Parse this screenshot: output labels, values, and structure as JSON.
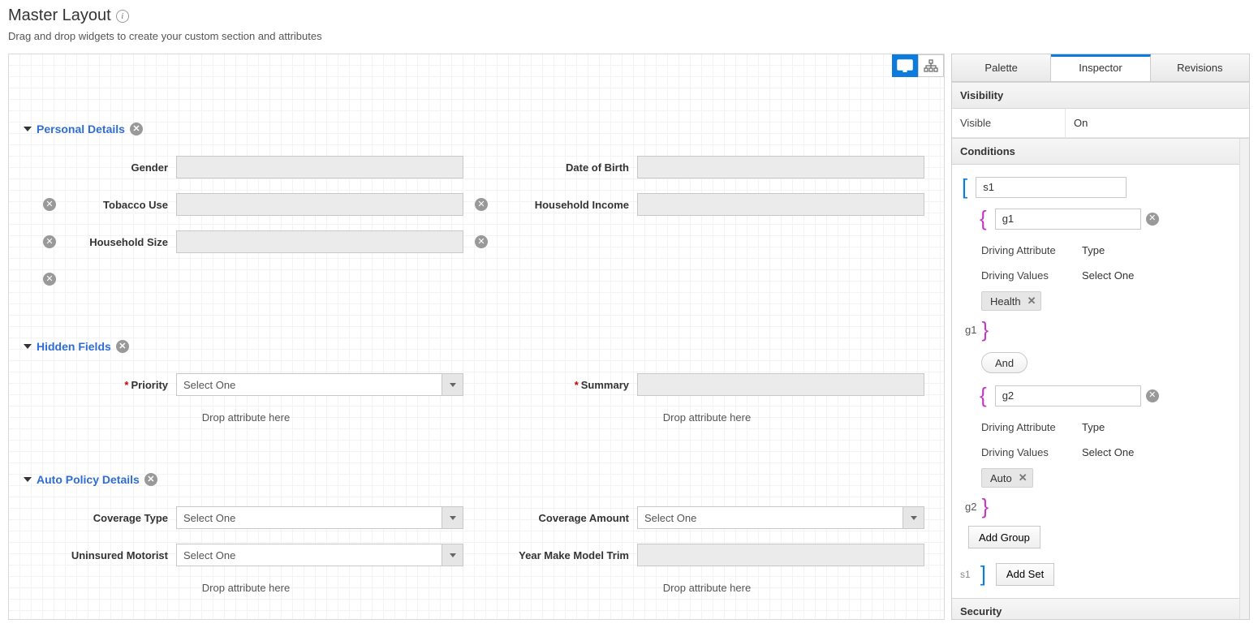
{
  "header": {
    "title": "Master Layout",
    "subtitle": "Drag and drop widgets to create your custom section and attributes"
  },
  "canvas": {
    "select_placeholder": "Select One",
    "drop_hint": "Drop attribute here",
    "sections": {
      "personal": {
        "title": "Personal Details",
        "fields": {
          "gender": "Gender",
          "dob": "Date of Birth",
          "tobacco": "Tobacco Use",
          "income": "Household Income",
          "hh_size": "Household Size"
        }
      },
      "hidden": {
        "title": "Hidden Fields",
        "fields": {
          "priority": "Priority",
          "summary": "Summary"
        }
      },
      "auto": {
        "title": "Auto Policy Details",
        "fields": {
          "ctype": "Coverage Type",
          "camount": "Coverage Amount",
          "umotor": "Uninsured Motorist",
          "ymmt": "Year Make Model Trim"
        }
      }
    }
  },
  "panel": {
    "tabs": {
      "palette": "Palette",
      "inspector": "Inspector",
      "revisions": "Revisions"
    },
    "visibility": {
      "header": "Visibility",
      "visible_label": "Visible",
      "visible_value": "On"
    },
    "conditions": {
      "header": "Conditions",
      "set_id": "s1",
      "groups": [
        {
          "id": "g1",
          "driving_attr_label": "Driving Attribute",
          "driving_attr_value": "Type",
          "driving_values_label": "Driving Values",
          "driving_values_value": "Select One",
          "chip": "Health"
        },
        {
          "id": "g2",
          "driving_attr_label": "Driving Attribute",
          "driving_attr_value": "Type",
          "driving_values_label": "Driving Values",
          "driving_values_value": "Select One",
          "chip": "Auto"
        }
      ],
      "join": "And",
      "add_group": "Add Group",
      "add_set": "Add Set",
      "close_set_label": "s1"
    },
    "security": {
      "header": "Security"
    }
  }
}
